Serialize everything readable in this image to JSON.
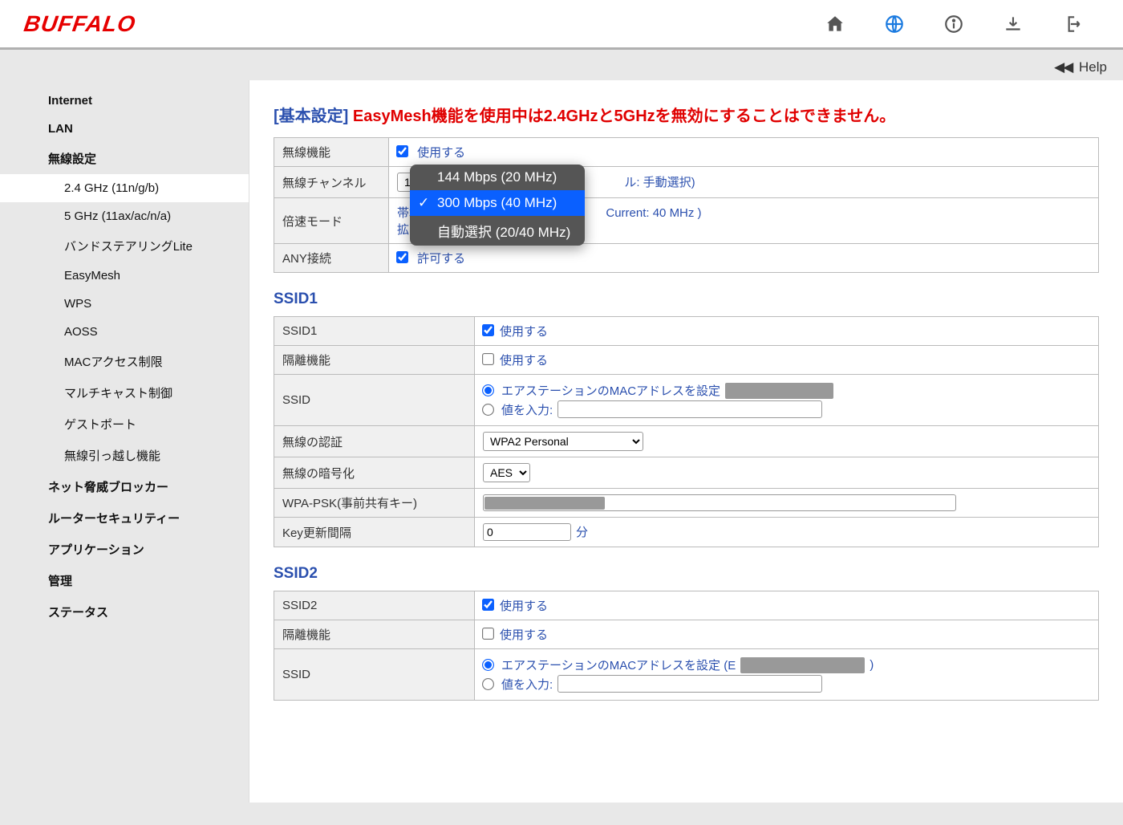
{
  "brand": "BUFFALO",
  "help_label": "Help",
  "sidebar": {
    "items": [
      {
        "label": "Internet",
        "type": "parent"
      },
      {
        "label": "LAN",
        "type": "parent"
      },
      {
        "label": "無線設定",
        "type": "parent"
      },
      {
        "label": "2.4 GHz (11n/g/b)",
        "type": "sub",
        "selected": true
      },
      {
        "label": "5 GHz (11ax/ac/n/a)",
        "type": "sub"
      },
      {
        "label": "バンドステアリングLite",
        "type": "sub"
      },
      {
        "label": "EasyMesh",
        "type": "sub"
      },
      {
        "label": "WPS",
        "type": "sub"
      },
      {
        "label": "AOSS",
        "type": "sub"
      },
      {
        "label": "MACアクセス制限",
        "type": "sub"
      },
      {
        "label": "マルチキャスト制御",
        "type": "sub"
      },
      {
        "label": "ゲストポート",
        "type": "sub"
      },
      {
        "label": "無線引っ越し機能",
        "type": "sub"
      },
      {
        "label": "ネット脅威ブロッカー",
        "type": "parent"
      },
      {
        "label": "ルーターセキュリティー",
        "type": "parent"
      },
      {
        "label": "アプリケーション",
        "type": "parent"
      },
      {
        "label": "管理",
        "type": "parent"
      },
      {
        "label": "ステータス",
        "type": "parent"
      }
    ]
  },
  "title": {
    "bracket": "[基本設定]",
    "warn": "EasyMesh機能を使用中は2.4GHzと5GHzを無効にすることはできません。"
  },
  "basic": {
    "rows": {
      "wireless": {
        "label": "無線機能",
        "checkbox": "使用する"
      },
      "channel": {
        "label": "無線チャンネル",
        "select": "1 チ",
        "trail": "ル: 手動選択)"
      },
      "double": {
        "label": "倍速モード",
        "line1_prefix": "帯域",
        "line1_suffix": "Current: 40 MHz )",
        "line2_prefix": "拡張"
      },
      "any": {
        "label": "ANY接続",
        "checkbox": "許可する"
      }
    }
  },
  "popup": {
    "items": [
      "144 Mbps (20 MHz)",
      "300 Mbps (40 MHz)",
      "自動選択 (20/40 MHz)"
    ],
    "selected_index": 1
  },
  "ssid1": {
    "heading": "SSID1",
    "rows": {
      "enable": {
        "label": "SSID1",
        "checkbox": "使用する"
      },
      "isolate": {
        "label": "隔離機能",
        "checkbox": "使用する"
      },
      "ssid": {
        "label": "SSID",
        "radio_mac": "エアステーションのMACアドレスを設定",
        "radio_input": "値を入力:"
      },
      "auth": {
        "label": "無線の認証",
        "value": "WPA2 Personal"
      },
      "enc": {
        "label": "無線の暗号化",
        "value": "AES"
      },
      "psk": {
        "label": "WPA-PSK(事前共有キー)"
      },
      "rekey": {
        "label": "Key更新間隔",
        "value": "0",
        "unit": "分"
      }
    }
  },
  "ssid2": {
    "heading": "SSID2",
    "rows": {
      "enable": {
        "label": "SSID2",
        "checkbox": "使用する"
      },
      "isolate": {
        "label": "隔離機能",
        "checkbox": "使用する"
      },
      "ssid": {
        "label": "SSID",
        "radio_mac_prefix": "エアステーションのMACアドレスを設定 (E",
        "radio_mac_suffix": ")",
        "radio_input": "値を入力:"
      }
    }
  }
}
